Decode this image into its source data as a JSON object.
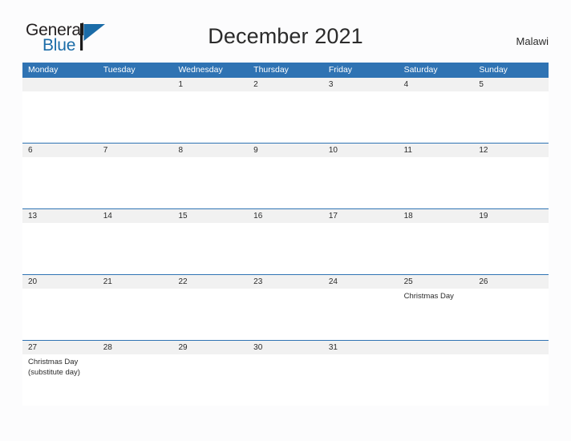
{
  "brand": {
    "name_part1": "General",
    "name_part2": "Blue",
    "flag_icon": "blue-triangle-flag-icon",
    "accent_color": "#1b6ca8"
  },
  "header": {
    "title": "December 2021",
    "locale": "Malawi"
  },
  "calendar": {
    "header_color": "#2f73b3",
    "date_band_color": "#f1f1f1",
    "weekdays": [
      "Monday",
      "Tuesday",
      "Wednesday",
      "Thursday",
      "Friday",
      "Saturday",
      "Sunday"
    ],
    "weeks": [
      {
        "days": [
          {
            "date": "",
            "events": []
          },
          {
            "date": "",
            "events": []
          },
          {
            "date": "1",
            "events": []
          },
          {
            "date": "2",
            "events": []
          },
          {
            "date": "3",
            "events": []
          },
          {
            "date": "4",
            "events": []
          },
          {
            "date": "5",
            "events": []
          }
        ]
      },
      {
        "days": [
          {
            "date": "6",
            "events": []
          },
          {
            "date": "7",
            "events": []
          },
          {
            "date": "8",
            "events": []
          },
          {
            "date": "9",
            "events": []
          },
          {
            "date": "10",
            "events": []
          },
          {
            "date": "11",
            "events": []
          },
          {
            "date": "12",
            "events": []
          }
        ]
      },
      {
        "days": [
          {
            "date": "13",
            "events": []
          },
          {
            "date": "14",
            "events": []
          },
          {
            "date": "15",
            "events": []
          },
          {
            "date": "16",
            "events": []
          },
          {
            "date": "17",
            "events": []
          },
          {
            "date": "18",
            "events": []
          },
          {
            "date": "19",
            "events": []
          }
        ]
      },
      {
        "days": [
          {
            "date": "20",
            "events": []
          },
          {
            "date": "21",
            "events": []
          },
          {
            "date": "22",
            "events": []
          },
          {
            "date": "23",
            "events": []
          },
          {
            "date": "24",
            "events": []
          },
          {
            "date": "25",
            "events": [
              "Christmas Day"
            ]
          },
          {
            "date": "26",
            "events": []
          }
        ]
      },
      {
        "days": [
          {
            "date": "27",
            "events": [
              "Christmas Day",
              "(substitute day)"
            ]
          },
          {
            "date": "28",
            "events": []
          },
          {
            "date": "29",
            "events": []
          },
          {
            "date": "30",
            "events": []
          },
          {
            "date": "31",
            "events": []
          },
          {
            "date": "",
            "events": []
          },
          {
            "date": "",
            "events": []
          }
        ]
      }
    ]
  }
}
